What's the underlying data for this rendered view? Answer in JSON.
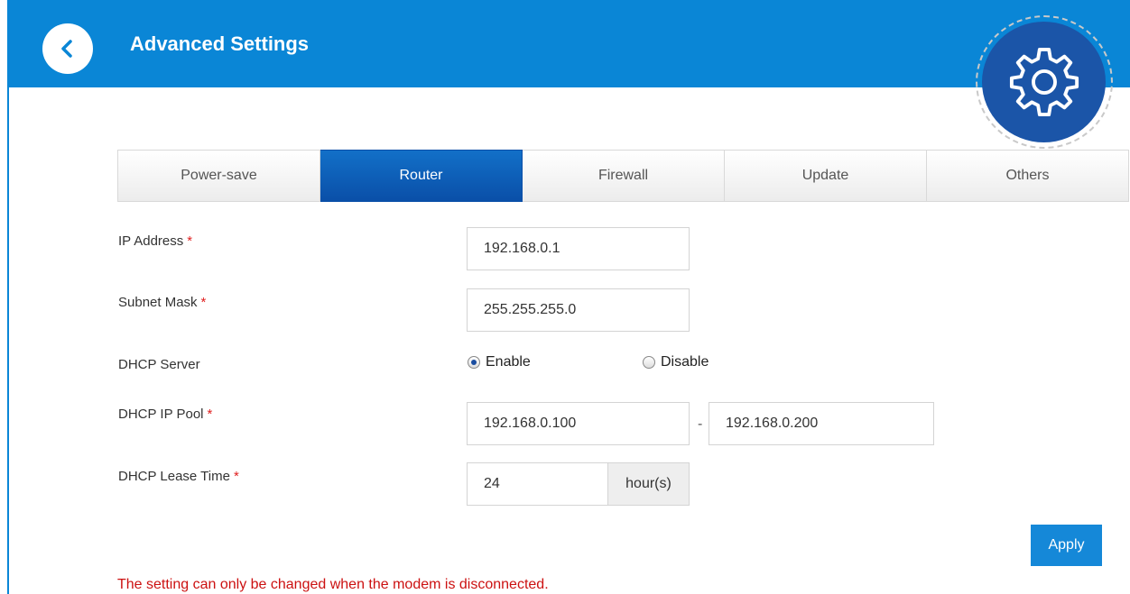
{
  "header": {
    "title": "Advanced Settings",
    "back_icon": "chevron-left-icon",
    "gear_icon": "gear-icon"
  },
  "tabs": [
    {
      "label": "Power-save",
      "active": false
    },
    {
      "label": "Router",
      "active": true
    },
    {
      "label": "Firewall",
      "active": false
    },
    {
      "label": "Update",
      "active": false
    },
    {
      "label": "Others",
      "active": false
    }
  ],
  "form": {
    "ip_address": {
      "label": "IP Address",
      "required": "*",
      "value": "192.168.0.1"
    },
    "subnet_mask": {
      "label": "Subnet Mask",
      "required": "*",
      "value": "255.255.255.0"
    },
    "dhcp_server": {
      "label": "DHCP Server",
      "enable_label": "Enable",
      "disable_label": "Disable",
      "selected": "Enable"
    },
    "dhcp_ip_pool": {
      "label": "DHCP IP Pool",
      "required": "*",
      "start": "192.168.0.100",
      "separator": "-",
      "end": "192.168.0.200"
    },
    "dhcp_lease_time": {
      "label": "DHCP Lease Time",
      "required": "*",
      "value": "24",
      "unit": "hour(s)"
    }
  },
  "apply_label": "Apply",
  "note": "The setting can only be changed when the modem is disconnected.",
  "colors": {
    "header": "#0a86d6",
    "active_tab": "#0a4fa8",
    "gear_circle": "#1b55a8",
    "required": "#e02020",
    "note": "#cc1111",
    "apply": "#1588d8"
  }
}
